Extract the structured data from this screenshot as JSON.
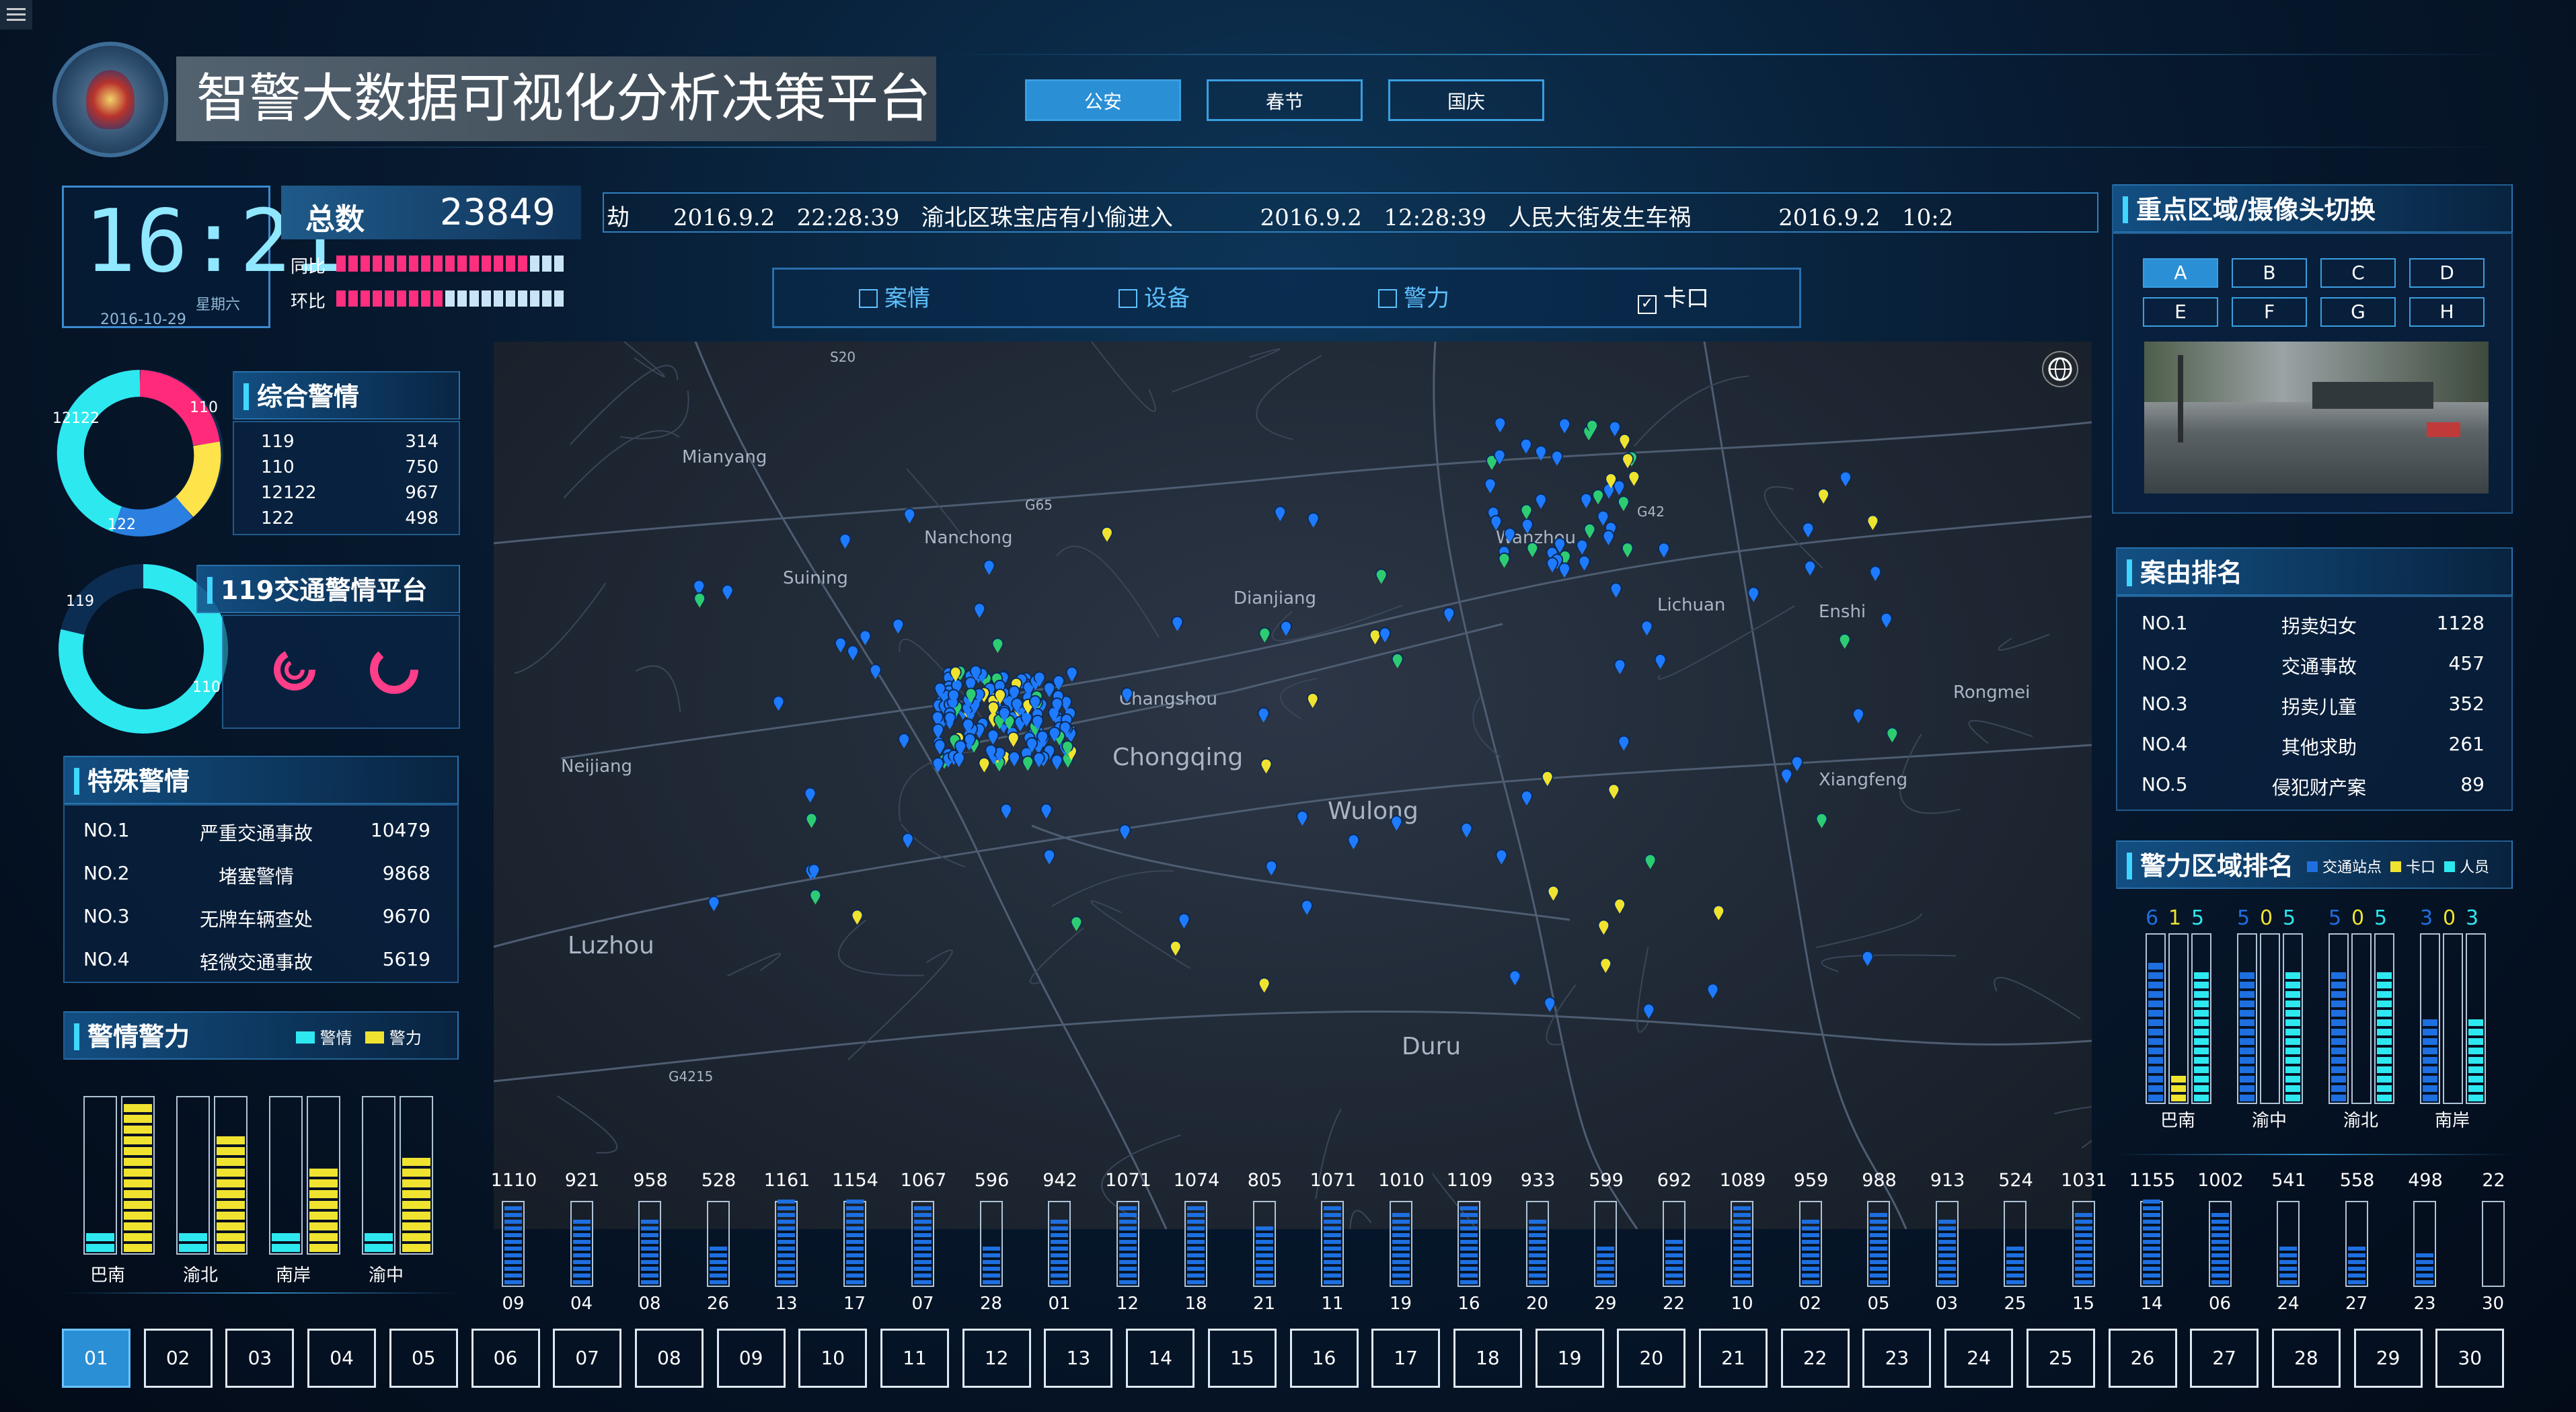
{
  "title": "智警大数据可视化分析决策平台",
  "top_tabs": [
    "公安",
    "春节",
    "国庆"
  ],
  "clock": {
    "time": "16:21",
    "weekday": "星期六",
    "date": "2016-10-29"
  },
  "total": {
    "label": "总数",
    "value": "23849",
    "yoy_label": "同比",
    "mom_label": "环比",
    "yoy": 0.83,
    "mom": 0.45
  },
  "ticker": "劫      2016.9.2   22:28:39   渝北区珠宝店有小偷进入            2016.9.2   12:28:39   人民大街发生车祸            2016.9.2   10:2",
  "filters": [
    {
      "label": "案情",
      "checked": false
    },
    {
      "label": "设备",
      "checked": false
    },
    {
      "label": "警力",
      "checked": false
    },
    {
      "label": "卡口",
      "checked": true
    }
  ],
  "summary": {
    "title": "综合警情",
    "rows": [
      [
        "119",
        "314"
      ],
      [
        "110",
        "750"
      ],
      [
        "12122",
        "967"
      ],
      [
        "122",
        "498"
      ]
    ],
    "donut_labels": [
      "110",
      "12122",
      "122"
    ]
  },
  "traffic": {
    "title": "119交通警情平台",
    "labels": [
      "119",
      "110"
    ]
  },
  "special": {
    "title": "特殊警情",
    "rows": [
      [
        "NO.1",
        "严重交通事故",
        "10479"
      ],
      [
        "NO.2",
        "堵塞警情",
        "9868"
      ],
      [
        "NO.3",
        "无牌车辆查处",
        "9670"
      ],
      [
        "NO.4",
        "轻微交通事故",
        "5619"
      ]
    ]
  },
  "force": {
    "title": "警情警力",
    "legend": [
      "警情",
      "警力"
    ],
    "colors": {
      "a": "#2ee8f0",
      "b": "#f0e330"
    },
    "groups": [
      {
        "name": "巴南",
        "a": 0.15,
        "b": 0.9
      },
      {
        "name": "渝北",
        "a": 0.15,
        "b": 0.72
      },
      {
        "name": "南岸",
        "a": 0.12,
        "b": 0.52
      },
      {
        "name": "渝中",
        "a": 0.12,
        "b": 0.58
      }
    ]
  },
  "camera": {
    "title": "重点区域/摄像头切换",
    "buttons": [
      "A",
      "B",
      "C",
      "D",
      "E",
      "F",
      "G",
      "H"
    ]
  },
  "cases": {
    "title": "案由排名",
    "rows": [
      [
        "NO.1",
        "拐卖妇女",
        "1128"
      ],
      [
        "NO.2",
        "交通事故",
        "457"
      ],
      [
        "NO.3",
        "拐卖儿童",
        "352"
      ],
      [
        "NO.4",
        "其他求助",
        "261"
      ],
      [
        "NO.5",
        "侵犯财产案",
        "89"
      ]
    ]
  },
  "area": {
    "title": "警力区域排名",
    "legend": [
      "交通站点",
      "卡口",
      "人员"
    ],
    "colors": {
      "a": "#1e6fe0",
      "b": "#f0e330",
      "c": "#2ee8f0"
    },
    "groups": [
      {
        "name": "巴南",
        "nums": [
          "6",
          "1",
          "5"
        ],
        "a": 0.85,
        "b": 0.15,
        "c": 0.78
      },
      {
        "name": "渝中",
        "nums": [
          "5",
          "0",
          "5"
        ],
        "a": 0.78,
        "b": 0.0,
        "c": 0.78
      },
      {
        "name": "渝北",
        "nums": [
          "5",
          "0",
          "5"
        ],
        "a": 0.78,
        "b": 0.0,
        "c": 0.78
      },
      {
        "name": "南岸",
        "nums": [
          "3",
          "0",
          "3"
        ],
        "a": 0.48,
        "b": 0.0,
        "c": 0.48
      }
    ]
  },
  "map_labels": [
    "Mianyang",
    "Nanchong",
    "Suining",
    "Dianjiang",
    "Wanzhou",
    "Lichuan",
    "Enshi",
    "Changshou",
    "Chongqing",
    "Neijiang",
    "Wulong",
    "Xiangfeng",
    "Rongmei",
    "Luzhou",
    "Duru",
    "G65",
    "G42",
    "G4215",
    "S20"
  ],
  "bottom_chart": {
    "values": [
      "1110",
      "921",
      "958",
      "528",
      "1161",
      "1154",
      "1067",
      "596",
      "942",
      "1071",
      "1074",
      "805",
      "1071",
      "1010",
      "1109",
      "933",
      "599",
      "692",
      "1089",
      "959",
      "988",
      "913",
      "524",
      "1031",
      "1155",
      "1002",
      "541",
      "558",
      "498",
      "22"
    ],
    "days": [
      "09",
      "04",
      "08",
      "26",
      "13",
      "17",
      "07",
      "28",
      "01",
      "12",
      "18",
      "21",
      "11",
      "19",
      "16",
      "20",
      "29",
      "22",
      "10",
      "02",
      "05",
      "03",
      "25",
      "15",
      "14",
      "06",
      "24",
      "27",
      "23",
      "30"
    ],
    "max": 1200
  },
  "days_nav": [
    "01",
    "02",
    "03",
    "04",
    "05",
    "06",
    "07",
    "08",
    "09",
    "10",
    "11",
    "12",
    "13",
    "14",
    "15",
    "16",
    "17",
    "18",
    "19",
    "20",
    "21",
    "22",
    "23",
    "24",
    "25",
    "26",
    "27",
    "28",
    "29",
    "30"
  ]
}
